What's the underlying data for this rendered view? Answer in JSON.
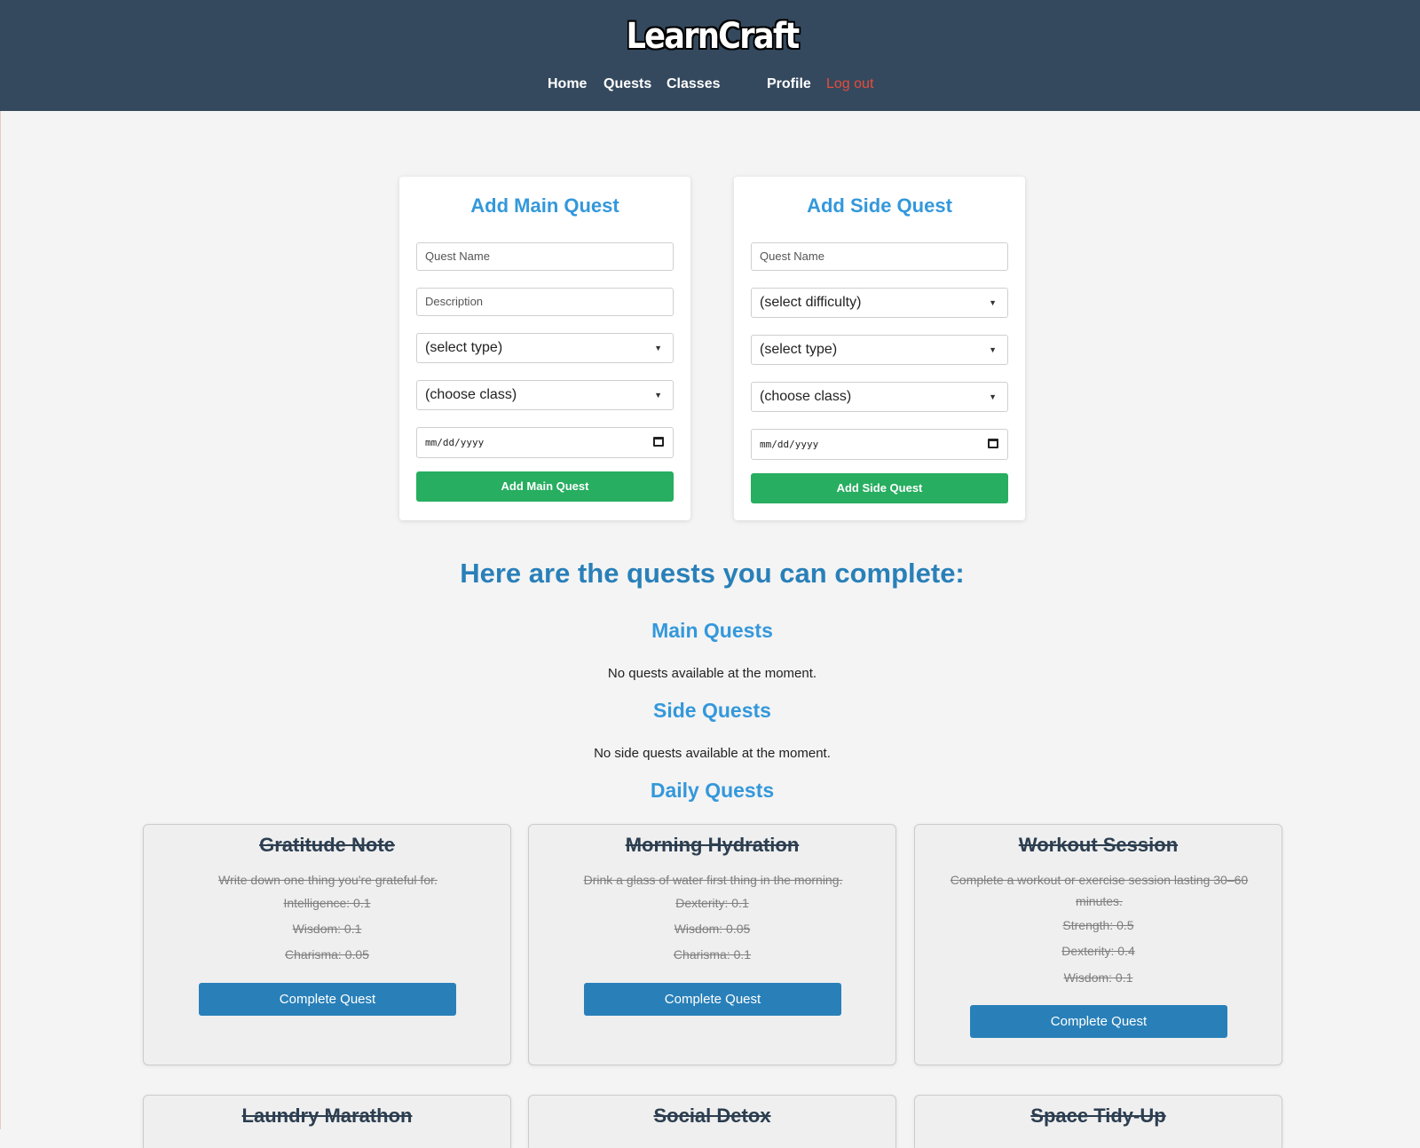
{
  "header": {
    "logo": "LearnCraft",
    "nav": [
      {
        "label": "Home"
      },
      {
        "label": "Quests"
      },
      {
        "label": "Classes"
      },
      {
        "label": "Profile"
      },
      {
        "label": "Log out"
      }
    ]
  },
  "main_form": {
    "title": "Add Main Quest",
    "quest_name_placeholder": "Quest Name",
    "description_placeholder": "Description",
    "type_select": "(select type)",
    "class_select": "(choose class)",
    "date_placeholder": "mm/dd/yyyy",
    "submit_label": "Add Main Quest"
  },
  "side_form": {
    "title": "Add Side Quest",
    "quest_name_placeholder": "Quest Name",
    "difficulty_select": "(select difficulty)",
    "type_select": "(select type)",
    "class_select": "(choose class)",
    "date_placeholder": "mm/dd/yyyy",
    "submit_label": "Add Side Quest"
  },
  "quests": {
    "heading": "Here are the quests you can complete:",
    "main": {
      "title": "Main Quests",
      "empty": "No quests available at the moment."
    },
    "side": {
      "title": "Side Quests",
      "empty": "No side quests available at the moment."
    },
    "daily": {
      "title": "Daily Quests",
      "cards": [
        {
          "title": "Gratitude Note",
          "description": "Write down one thing you're grateful for.",
          "stats": [
            "Intelligence: 0.1",
            "Wisdom: 0.1",
            "Charisma: 0.05"
          ],
          "button": "Complete Quest"
        },
        {
          "title": "Morning Hydration",
          "description": "Drink a glass of water first thing in the morning.",
          "stats": [
            "Dexterity: 0.1",
            "Wisdom: 0.05",
            "Charisma: 0.1"
          ],
          "button": "Complete Quest"
        },
        {
          "title": "Workout Session",
          "description": "Complete a workout or exercise session lasting 30–60 minutes.",
          "stats": [
            "Strength: 0.5",
            "Dexterity: 0.4",
            "Wisdom: 0.1"
          ],
          "button": "Complete Quest"
        },
        {
          "title": "Laundry Marathon"
        },
        {
          "title": "Social Detox"
        },
        {
          "title": "Space Tidy-Up"
        }
      ]
    }
  },
  "colors": {
    "header_bg": "#34495e",
    "accent_blue": "#3498db",
    "button_blue": "#2980b9",
    "button_green": "#27ae60",
    "logout_red": "#e74c3c"
  }
}
